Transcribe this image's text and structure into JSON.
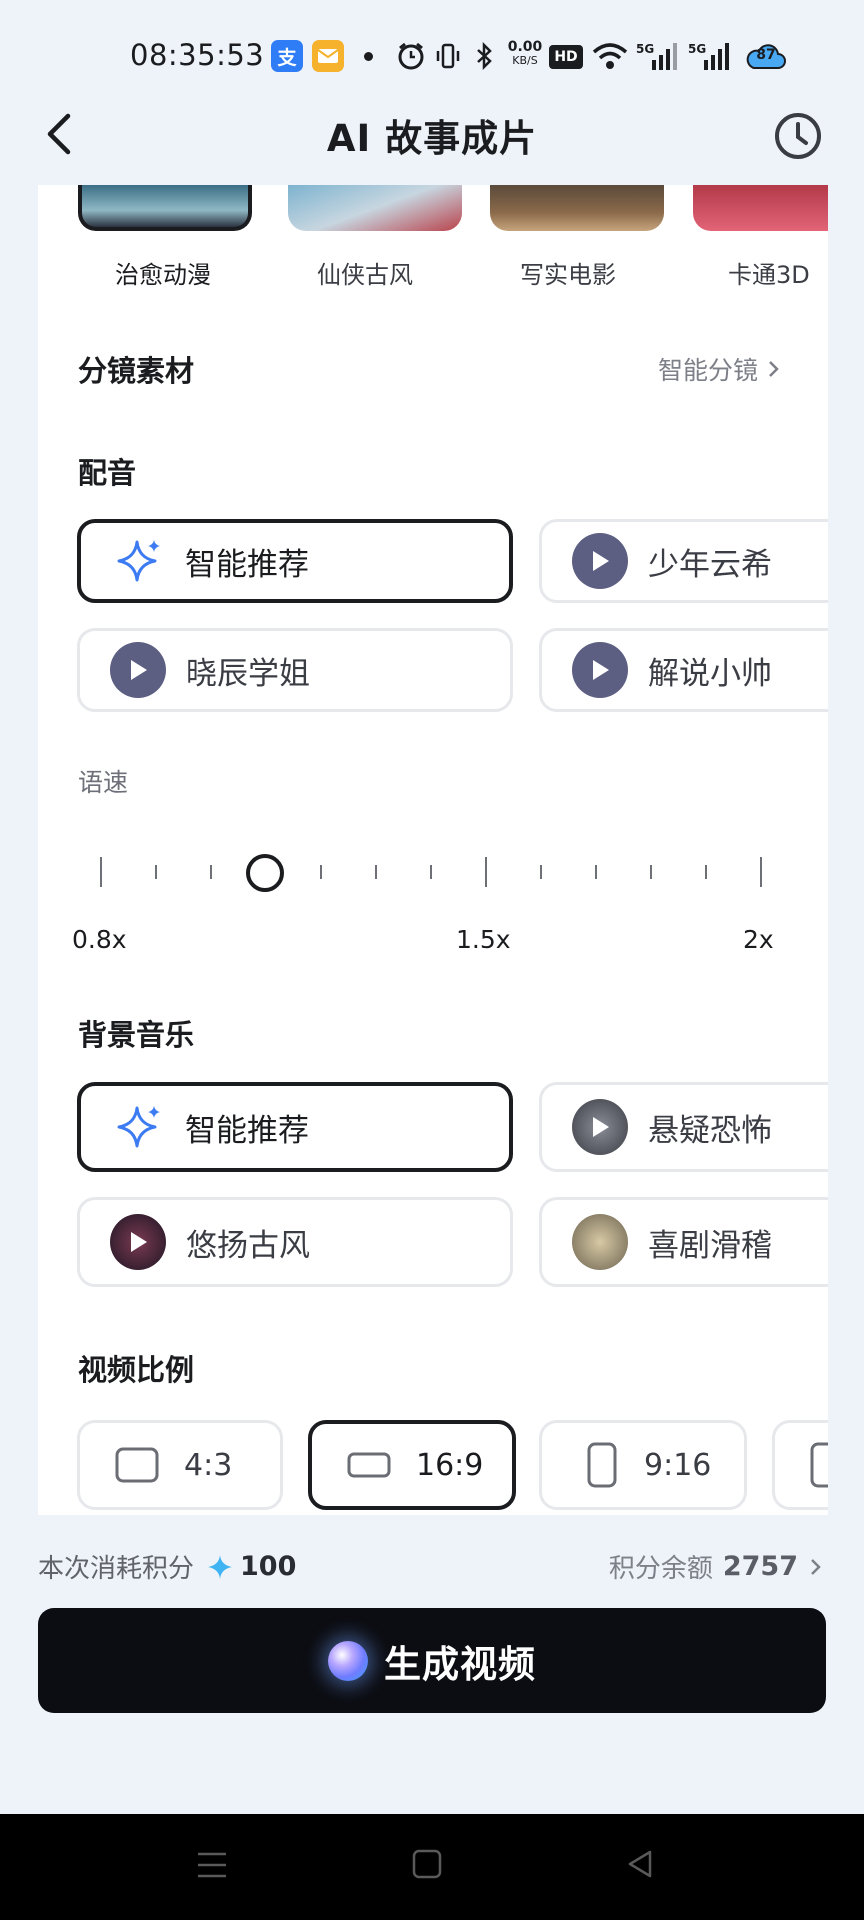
{
  "status_bar": {
    "time": "08:35:53",
    "app1": "支",
    "net_speed": "0.00",
    "net_unit": "KB/S",
    "hd": "HD",
    "sim1": "5G",
    "sim2": "5G",
    "battery": "87"
  },
  "header": {
    "title": "AI 故事成片"
  },
  "styles": [
    {
      "label": "治愈动漫",
      "selected": true
    },
    {
      "label": "仙侠古风",
      "selected": false
    },
    {
      "label": "写实电影",
      "selected": false
    },
    {
      "label": "卡通3D",
      "selected": false
    }
  ],
  "storyboard": {
    "title": "分镜素材",
    "link": "智能分镜"
  },
  "dubbing": {
    "title": "配音",
    "options": [
      {
        "label": "智能推荐",
        "selected": true
      },
      {
        "label": "少年云希",
        "selected": false
      },
      {
        "label": "晓辰学姐",
        "selected": false
      },
      {
        "label": "解说小帅",
        "selected": false
      }
    ]
  },
  "speed": {
    "label": "语速",
    "min_label": "0.8x",
    "mid_label": "1.5x",
    "max_label": "2x",
    "value": 1.1
  },
  "music": {
    "title": "背景音乐",
    "options": [
      {
        "label": "智能推荐",
        "selected": true
      },
      {
        "label": "悬疑恐怖",
        "selected": false
      },
      {
        "label": "悠扬古风",
        "selected": false
      },
      {
        "label": "喜剧滑稽",
        "selected": false
      }
    ]
  },
  "ratio": {
    "title": "视频比例",
    "options": [
      {
        "label": "4:3",
        "selected": false
      },
      {
        "label": "16:9",
        "selected": true
      },
      {
        "label": "9:16",
        "selected": false
      }
    ]
  },
  "footer": {
    "cost_label": "本次消耗积分",
    "cost_value": "100",
    "balance_label": "积分余额",
    "balance_value": "2757",
    "generate_label": "生成视频"
  },
  "colors": {
    "accent_blue": "#3d7bf2",
    "play_purple": "#5c5e82",
    "button_dark": "#0c0d12"
  }
}
